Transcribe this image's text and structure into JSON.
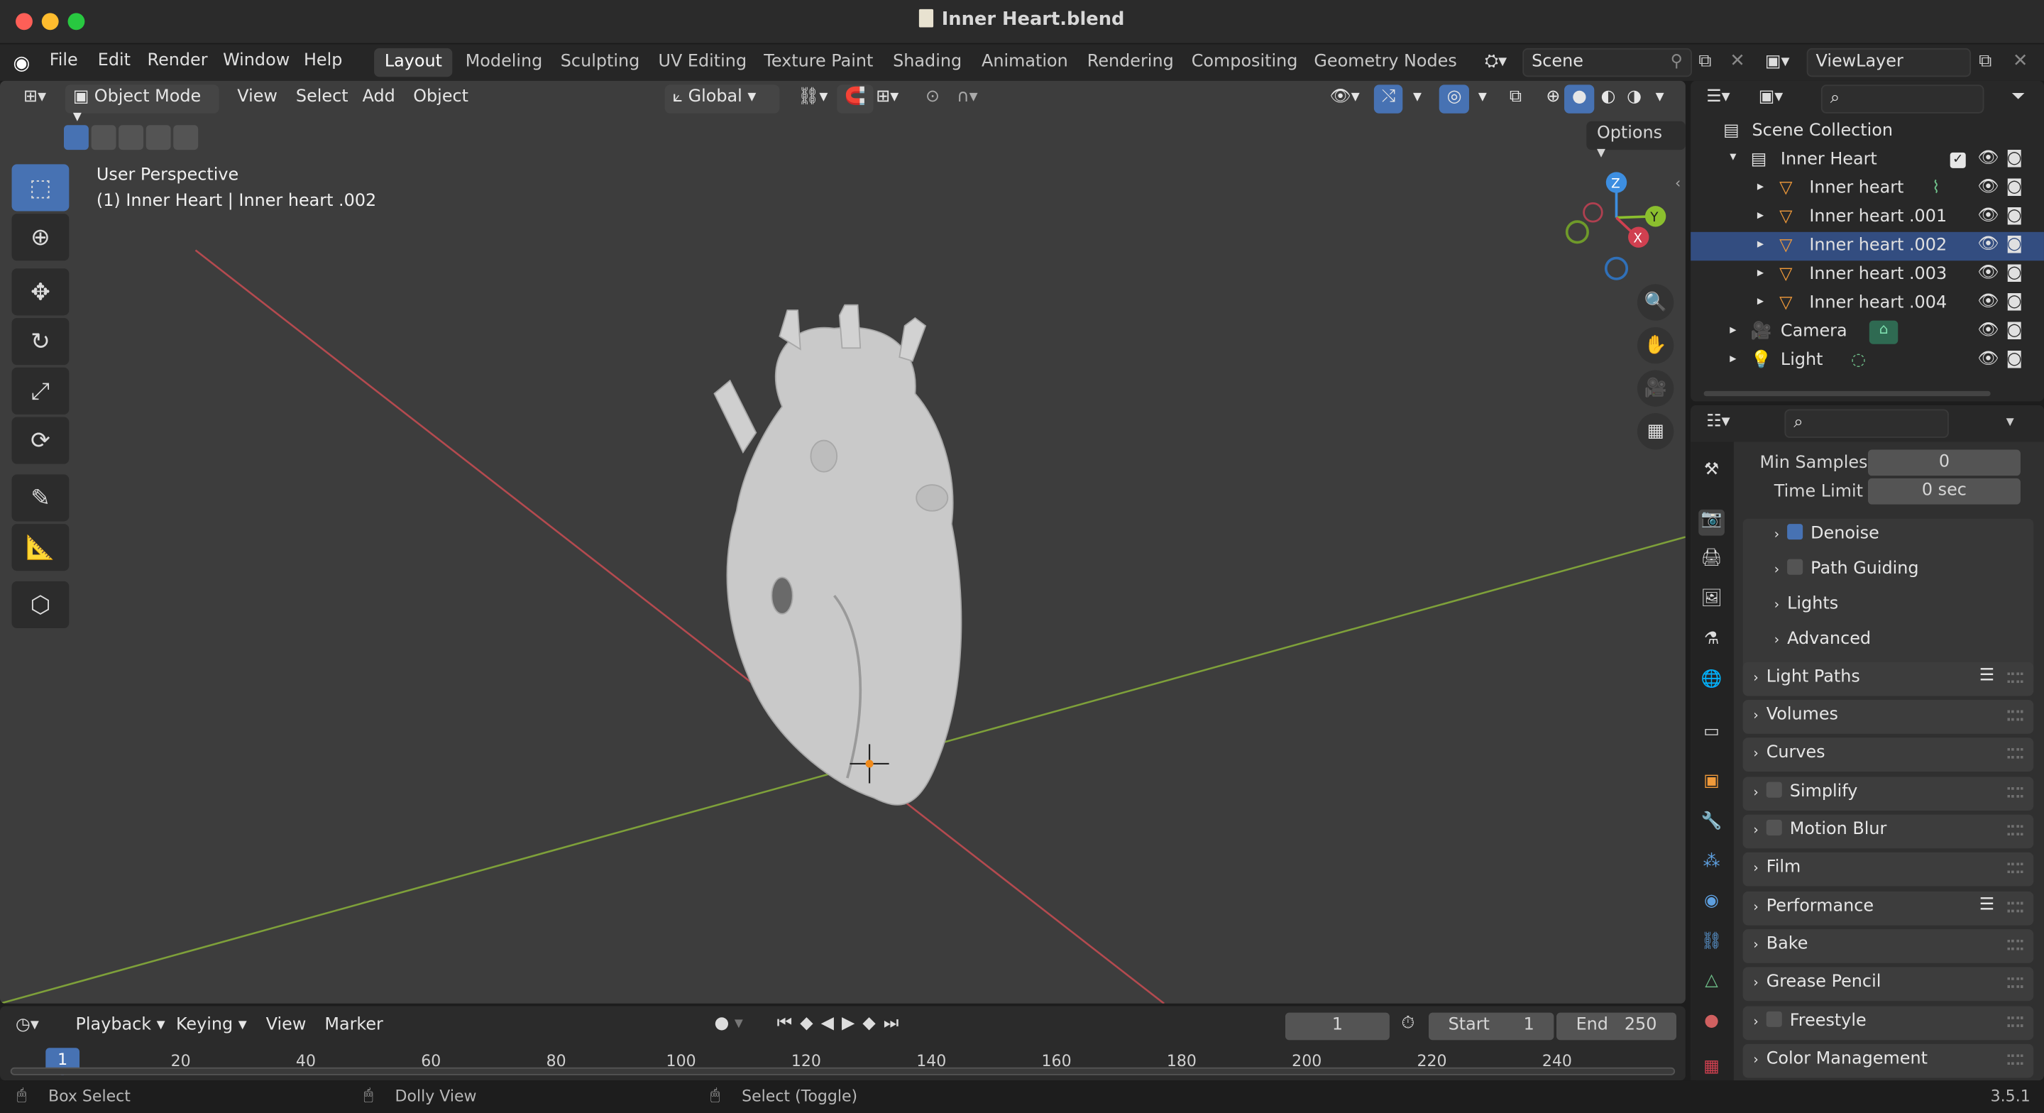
{
  "window": {
    "title": "Inner Heart.blend"
  },
  "menu": [
    "File",
    "Edit",
    "Render",
    "Window",
    "Help"
  ],
  "workspaces": [
    "Layout",
    "Modeling",
    "Sculpting",
    "UV Editing",
    "Texture Paint",
    "Shading",
    "Animation",
    "Rendering",
    "Compositing",
    "Geometry Nodes"
  ],
  "active_workspace": "Layout",
  "scene": {
    "name": "Scene",
    "view_layer": "ViewLayer"
  },
  "viewport": {
    "mode": "Object Mode",
    "menus": [
      "View",
      "Select",
      "Add",
      "Object"
    ],
    "transform_orientation": "Global",
    "options_label": "Options",
    "perspective_label": "User Perspective",
    "object_label": "(1) Inner Heart | Inner heart .002",
    "gizmo_axes": {
      "z": "Z",
      "y": "Y",
      "x": "X"
    }
  },
  "outliner": {
    "root": "Scene Collection",
    "items": [
      {
        "name": "Inner Heart",
        "type": "collection",
        "level": 1
      },
      {
        "name": "Inner heart",
        "type": "mesh",
        "level": 2
      },
      {
        "name": "Inner heart .001",
        "type": "mesh",
        "level": 2
      },
      {
        "name": "Inner heart .002",
        "type": "mesh",
        "level": 2,
        "selected": true
      },
      {
        "name": "Inner heart .003",
        "type": "mesh",
        "level": 2
      },
      {
        "name": "Inner heart .004",
        "type": "mesh",
        "level": 2
      },
      {
        "name": "Camera",
        "type": "camera",
        "level": 1
      },
      {
        "name": "Light",
        "type": "light",
        "level": 1
      }
    ]
  },
  "properties": {
    "min_samples": {
      "label": "Min Samples",
      "value": "0"
    },
    "time_limit": {
      "label": "Time Limit",
      "value": "0 sec"
    },
    "subpanels": [
      {
        "label": "Denoise",
        "checkbox": true,
        "checked": true
      },
      {
        "label": "Path Guiding",
        "checkbox": true,
        "checked": false
      },
      {
        "label": "Lights",
        "checkbox": false
      },
      {
        "label": "Advanced",
        "checkbox": false
      }
    ],
    "panels": [
      {
        "label": "Light Paths",
        "checkbox": false,
        "list_icon": true
      },
      {
        "label": "Volumes",
        "checkbox": false
      },
      {
        "label": "Curves",
        "checkbox": false
      },
      {
        "label": "Simplify",
        "checkbox": true
      },
      {
        "label": "Motion Blur",
        "checkbox": true
      },
      {
        "label": "Film",
        "checkbox": false
      },
      {
        "label": "Performance",
        "checkbox": false,
        "list_icon": true
      },
      {
        "label": "Bake",
        "checkbox": false
      },
      {
        "label": "Grease Pencil",
        "checkbox": false
      },
      {
        "label": "Freestyle",
        "checkbox": true
      },
      {
        "label": "Color Management",
        "checkbox": false
      }
    ]
  },
  "timeline": {
    "menus": [
      "Playback",
      "Keying",
      "View",
      "Marker"
    ],
    "current_frame": "1",
    "start_label": "Start",
    "start": "1",
    "end_label": "End",
    "end": "250",
    "ticks": [
      "1",
      "20",
      "40",
      "60",
      "80",
      "100",
      "120",
      "140",
      "160",
      "180",
      "200",
      "220",
      "240"
    ]
  },
  "status": {
    "left": "Box Select",
    "middle": "Dolly View",
    "right": "Select (Toggle)",
    "version": "3.5.1"
  },
  "colors": {
    "accent": "#4772b3",
    "selected_row": "#334d80",
    "x_axis": "#d04050",
    "y_axis": "#8bbf2e",
    "z_axis": "#3d8ee0"
  }
}
